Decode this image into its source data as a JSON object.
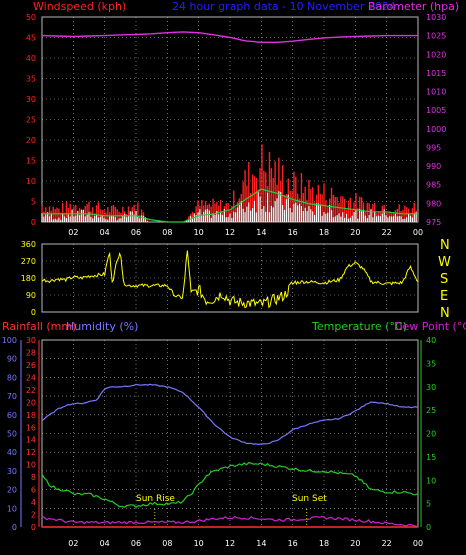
{
  "colors": {
    "background": "#000000",
    "frame": "#b8b8b8",
    "grid": "#b8b8b8",
    "wind_speed": "#ff2020",
    "wind_gust": "#ffffff",
    "wind_avg": "#22d03a",
    "barometer": "#e030e0",
    "direction": "#ffff00",
    "rainfall": "#ff3030",
    "humidity": "#7777ff",
    "temperature": "#22cc22",
    "dew_point": "#cc22cc",
    "title": "#2020ff",
    "compass": "#ffff00",
    "sun_label": "#ffff00",
    "x_ticks": "#ffffff"
  },
  "chart_data": [
    {
      "type": "line",
      "title": "24 hour graph data - 10 November 2024",
      "left_axis_label": "Windspeed (kph)",
      "right_axis_label": "Barometer (hpa)",
      "x_ticks": [
        "02",
        "04",
        "06",
        "08",
        "10",
        "12",
        "14",
        "16",
        "18",
        "20",
        "22",
        "00"
      ],
      "y_left_ticks": [
        "0",
        "5",
        "10",
        "15",
        "20",
        "25",
        "30",
        "35",
        "40",
        "45",
        "50"
      ],
      "y_left_range": [
        0,
        50
      ],
      "y_right_ticks": [
        "975",
        "980",
        "985",
        "990",
        "995",
        "1000",
        "1005",
        "1010",
        "1015",
        "1020",
        "1025",
        "1030"
      ],
      "y_right_range": [
        975,
        1030
      ],
      "x_range_hours": [
        0,
        24
      ],
      "series": [
        {
          "key": "wind_gust",
          "x": [
            0,
            1,
            2,
            3,
            4,
            5,
            6,
            7,
            8,
            9,
            10,
            11,
            12,
            13,
            14,
            15,
            16,
            17,
            18,
            19,
            20,
            21,
            22,
            23,
            24
          ],
          "values": [
            4,
            3,
            4,
            4,
            3,
            3,
            4,
            0,
            0,
            0,
            4,
            4,
            4,
            10,
            14,
            12,
            9,
            8,
            7,
            6,
            5,
            4,
            4,
            3,
            4
          ]
        },
        {
          "key": "wind_speed",
          "x": [
            0,
            1,
            2,
            3,
            4,
            5,
            6,
            7,
            8,
            9,
            10,
            11,
            12,
            13,
            14,
            15,
            16,
            17,
            18,
            19,
            20,
            21,
            22,
            23,
            24
          ],
          "values": [
            2,
            1,
            2,
            2,
            1,
            1,
            2,
            0,
            0,
            0,
            2,
            2,
            2,
            4,
            6,
            5,
            4,
            3,
            3,
            2,
            2,
            2,
            2,
            1,
            2
          ]
        },
        {
          "key": "wind_avg",
          "x": [
            0,
            1,
            2,
            3,
            4,
            5,
            6,
            7,
            8,
            9,
            10,
            11,
            12,
            13,
            14,
            15,
            16,
            17,
            18,
            19,
            20,
            21,
            22,
            23,
            24
          ],
          "values": [
            2,
            2,
            2,
            2,
            1.5,
            1.5,
            1.5,
            0.5,
            0,
            0,
            1.5,
            2,
            3,
            5.5,
            8,
            7,
            5.5,
            4.5,
            4,
            3.5,
            3,
            2.5,
            2.5,
            2,
            2
          ]
        },
        {
          "key": "barometer",
          "x": [
            0,
            1,
            2,
            3,
            4,
            5,
            6,
            7,
            8,
            9,
            10,
            11,
            12,
            13,
            14,
            15,
            16,
            17,
            18,
            19,
            20,
            21,
            22,
            23,
            24
          ],
          "values": [
            1025,
            1024.9,
            1024.8,
            1024.9,
            1025,
            1025.2,
            1025.3,
            1025.5,
            1025.8,
            1026,
            1025.8,
            1025.2,
            1024.5,
            1023.6,
            1023.2,
            1023.2,
            1023.5,
            1024,
            1024.4,
            1024.6,
            1024.8,
            1024.9,
            1025,
            1025,
            1025
          ]
        }
      ]
    },
    {
      "type": "line",
      "compass_labels": [
        "N",
        "W",
        "S",
        "E",
        "N"
      ],
      "y_ticks": [
        "0",
        "90",
        "180",
        "270",
        "360"
      ],
      "y_range": [
        0,
        360
      ],
      "x_range_hours": [
        0,
        24
      ],
      "series": [
        {
          "key": "direction",
          "x": [
            0,
            0.5,
            1,
            1.5,
            2,
            2.5,
            3,
            3.5,
            4,
            4.3,
            4.5,
            4.7,
            5,
            5.2,
            5.5,
            6,
            7,
            8,
            8.5,
            9,
            9.3,
            9.5,
            10,
            10.5,
            11,
            11.5,
            12,
            12.5,
            13,
            13.5,
            14,
            14.5,
            15,
            15.5,
            16,
            16.5,
            17,
            18,
            19,
            19.5,
            20,
            20.5,
            21,
            22,
            23,
            23.5,
            24
          ],
          "values": [
            170,
            165,
            175,
            170,
            185,
            180,
            190,
            195,
            200,
            320,
            150,
            240,
            330,
            155,
            140,
            140,
            140,
            140,
            85,
            75,
            340,
            90,
            120,
            60,
            70,
            100,
            60,
            50,
            50,
            45,
            40,
            55,
            70,
            90,
            150,
            160,
            160,
            155,
            170,
            240,
            260,
            230,
            160,
            150,
            155,
            240,
            160
          ]
        }
      ]
    },
    {
      "type": "line",
      "left_outer_label": "Rainfall (mm)",
      "left_inner_label": "Humidity (%)",
      "right_label_temperature": "Temperature (°C)",
      "right_label_dewpoint": "Dew Point (°C)",
      "x_ticks": [
        "02",
        "04",
        "06",
        "08",
        "10",
        "12",
        "14",
        "16",
        "18",
        "20",
        "22",
        "00"
      ],
      "humidity_ticks": [
        "0",
        "10",
        "20",
        "30",
        "40",
        "50",
        "60",
        "70",
        "80",
        "90",
        "100"
      ],
      "humidity_range": [
        0,
        100
      ],
      "rainfall_ticks": [
        "0",
        "2",
        "4",
        "6",
        "8",
        "10",
        "12",
        "14",
        "16",
        "18",
        "20",
        "22",
        "24",
        "26",
        "28",
        "30"
      ],
      "rainfall_range": [
        0,
        30
      ],
      "temperature_ticks": [
        "0",
        "5",
        "10",
        "15",
        "20",
        "25",
        "30",
        "35",
        "40"
      ],
      "temperature_range": [
        0,
        40
      ],
      "annotations": [
        {
          "text": "Sun Rise",
          "x": 7.2
        },
        {
          "text": "Sun Set",
          "x": 16.9
        }
      ],
      "x_range_hours": [
        0,
        24
      ],
      "series": [
        {
          "key": "humidity",
          "x": [
            0,
            0.5,
            1,
            1.5,
            2,
            2.5,
            3,
            3.5,
            4,
            4.5,
            5,
            6,
            7,
            8,
            9,
            10,
            11,
            12,
            13,
            14,
            15,
            16,
            17,
            18,
            19,
            20,
            21,
            22,
            23,
            24
          ],
          "values": [
            57,
            60,
            63,
            65,
            66,
            66,
            67,
            68,
            74,
            75,
            75,
            76,
            76,
            75,
            72,
            64,
            55,
            48,
            45,
            44,
            46,
            52,
            55,
            57,
            58,
            62,
            67,
            66,
            64,
            64
          ]
        },
        {
          "key": "temperature",
          "x": [
            0,
            0.5,
            1,
            1.5,
            2,
            3,
            3.5,
            4,
            5,
            6,
            7,
            8,
            8.5,
            9,
            9.5,
            10,
            10.5,
            11,
            12,
            13,
            14,
            15,
            16,
            17,
            18,
            19,
            20,
            21,
            22,
            23,
            24
          ],
          "values": [
            11,
            9,
            8,
            8,
            7,
            7,
            6.5,
            6,
            4.5,
            4.5,
            5,
            5,
            5,
            5.5,
            7,
            9,
            11,
            12,
            13,
            13.5,
            13.5,
            13,
            12.5,
            12,
            12,
            11.5,
            11,
            8,
            7.5,
            7.5,
            7
          ]
        },
        {
          "key": "dew_point",
          "x": [
            0,
            0.5,
            1,
            2,
            3,
            4,
            5,
            6,
            7,
            8,
            9,
            10,
            11,
            12,
            13,
            14,
            15,
            16,
            17,
            18,
            19,
            20,
            21,
            22,
            23,
            24
          ],
          "values": [
            2,
            1.8,
            1.5,
            1,
            1,
            0.9,
            1,
            1,
            1,
            1,
            1,
            1.3,
            1.8,
            2,
            2,
            1.8,
            1.5,
            1.6,
            1.8,
            2,
            1.8,
            1.5,
            1.2,
            0.8,
            0.5,
            0.3
          ]
        },
        {
          "key": "rainfall",
          "x": [
            0,
            24
          ],
          "values": [
            0,
            0
          ]
        }
      ]
    }
  ]
}
